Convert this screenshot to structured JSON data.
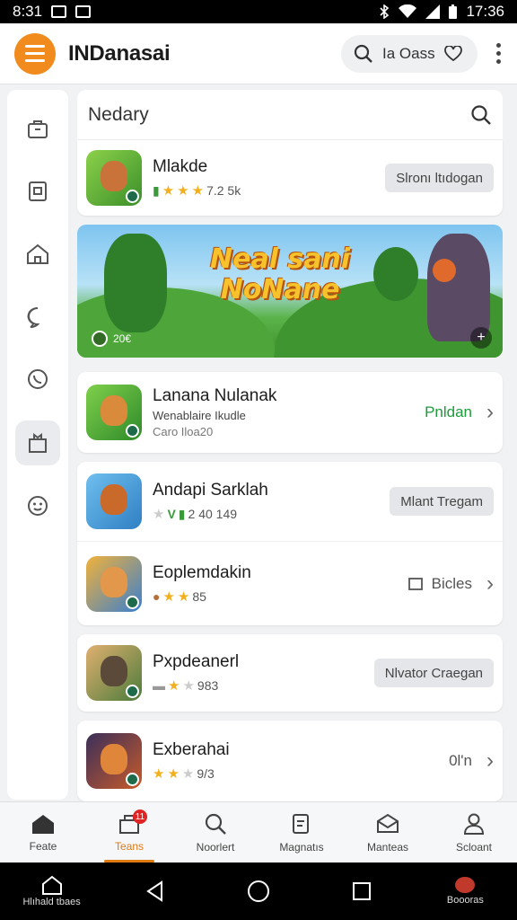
{
  "status_bar": {
    "time": "8:31",
    "clock": "17:36"
  },
  "app_bar": {
    "title": "INDanasai",
    "search_label": "Ia Oass"
  },
  "sidebar": {
    "items": [
      {
        "icon": "bag-icon",
        "active": false
      },
      {
        "icon": "save-icon",
        "active": false
      },
      {
        "icon": "home-icon",
        "active": false
      },
      {
        "icon": "chat-icon",
        "active": false
      },
      {
        "icon": "phone-icon",
        "active": false
      },
      {
        "icon": "store-icon",
        "active": true
      },
      {
        "icon": "smile-icon",
        "active": false
      }
    ]
  },
  "panel": {
    "title": "Nedary"
  },
  "featured_card": {
    "name": "Mlakde",
    "rating_text": "7.2 5k",
    "stars": 3,
    "action_label": "Slronı ltıdogan"
  },
  "banner": {
    "title_line1": "Neal sani",
    "title_line2": "NoNane",
    "meta": "20€"
  },
  "app_cards": [
    {
      "name": "Lanana Nulanak",
      "sub1": "Wenablaire Ikudle",
      "sub2": "Caro Iloa20",
      "action_label": "Pnldan",
      "action_type": "link-green"
    },
    {
      "name": "Andapi Sarklah",
      "rating_text": "2 40 149",
      "stars": 2,
      "action_label": "Mlant Tregam",
      "action_type": "button"
    },
    {
      "name": "Eoplemdakin",
      "rating_text": "85",
      "stars": 2,
      "action_label": "Bicles",
      "action_type": "link"
    },
    {
      "name": "Pxpdeanerl",
      "rating_text": "983",
      "stars": 1,
      "action_label": "Nlvator Craegan",
      "action_type": "button"
    },
    {
      "name": "Exberahai",
      "rating_text": "9/3",
      "stars": 3,
      "action_label": "0l'n",
      "action_type": "link"
    }
  ],
  "bottom_nav": {
    "items": [
      {
        "label": "Feate",
        "active": false
      },
      {
        "label": "Teans",
        "active": true,
        "badge": "11"
      },
      {
        "label": "Noorlert",
        "active": false
      },
      {
        "label": "Magnatıs",
        "active": false
      },
      {
        "label": "Manteas",
        "active": false
      },
      {
        "label": "Scloant",
        "active": false
      }
    ]
  },
  "system_bar": {
    "left_label": "Hlıhald tbaes",
    "right_label": "Boooras"
  },
  "colors": {
    "accent": "#f28b1e",
    "green": "#1e9a3a",
    "star": "#f2b01e"
  }
}
